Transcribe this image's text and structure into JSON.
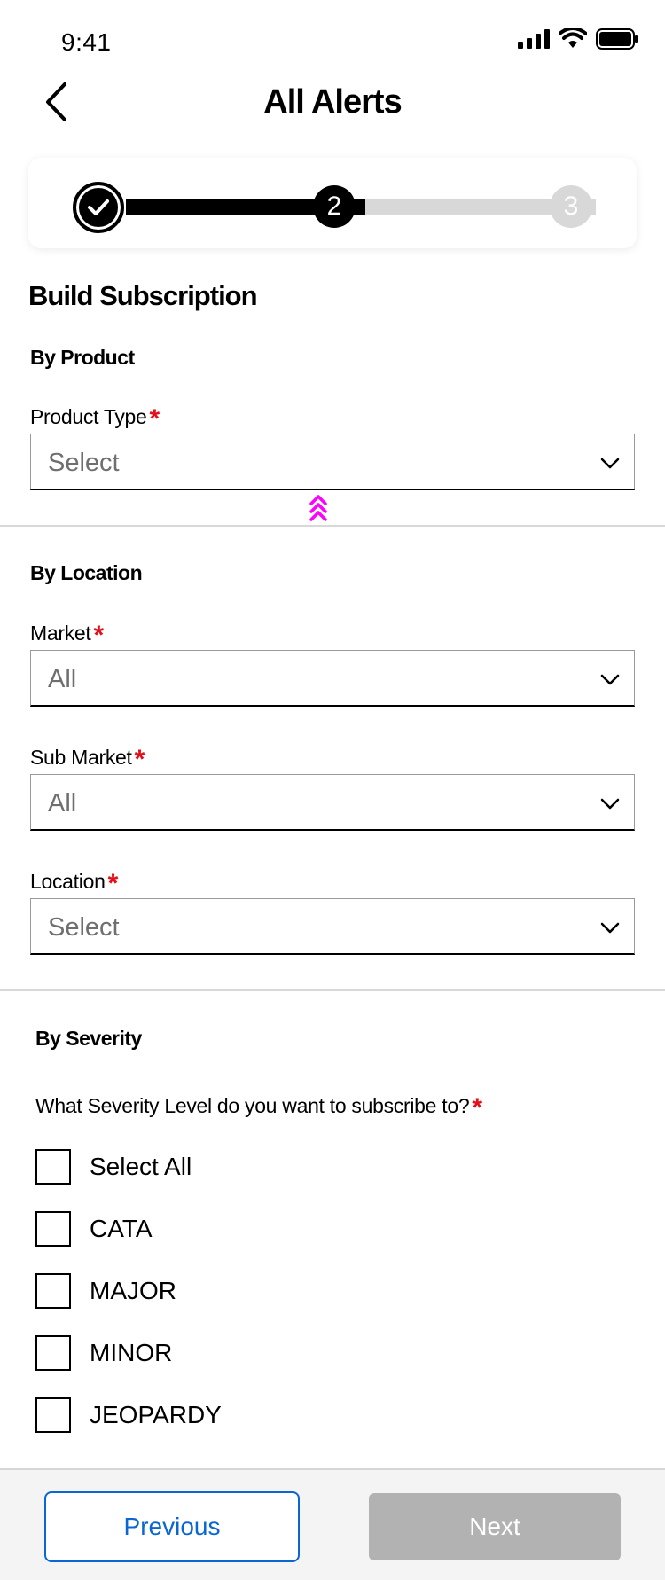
{
  "status_bar": {
    "time": "9:41",
    "icons": [
      "signal-icon",
      "wifi-icon",
      "battery-icon"
    ]
  },
  "header": {
    "title": "All Alerts",
    "back_icon": "chevron-left-icon"
  },
  "stepper": {
    "steps": [
      {
        "label": "",
        "state": "completed",
        "icon": "check-icon"
      },
      {
        "label": "2",
        "state": "current"
      },
      {
        "label": "3",
        "state": "upcoming"
      }
    ]
  },
  "page": {
    "title": "Build Subscription"
  },
  "by_product": {
    "title": "By Product",
    "product_type": {
      "label": "Product Type",
      "required_mark": "*",
      "value": "Select"
    }
  },
  "by_location": {
    "title": "By Location",
    "market": {
      "label": "Market",
      "required_mark": "*",
      "value": "All"
    },
    "sub_market": {
      "label": "Sub Market",
      "required_mark": "*",
      "value": "All"
    },
    "location": {
      "label": "Location",
      "required_mark": "*",
      "value": "Select"
    }
  },
  "by_severity": {
    "title": "By Severity",
    "question": "What Severity Level do you want to subscribe to?",
    "required_mark": "*",
    "options": [
      {
        "label": "Select All",
        "checked": false
      },
      {
        "label": "CATA",
        "checked": false
      },
      {
        "label": "MAJOR",
        "checked": false
      },
      {
        "label": "MINOR",
        "checked": false
      },
      {
        "label": "JEOPARDY",
        "checked": false
      }
    ]
  },
  "footer": {
    "previous_label": "Previous",
    "next_label": "Next",
    "next_enabled": false
  },
  "colors": {
    "accent_blue": "#0a66d3",
    "required_red": "#e3101a",
    "disabled_gray": "#b2b2b2",
    "drag_handle_magenta": "#ff00ff"
  }
}
